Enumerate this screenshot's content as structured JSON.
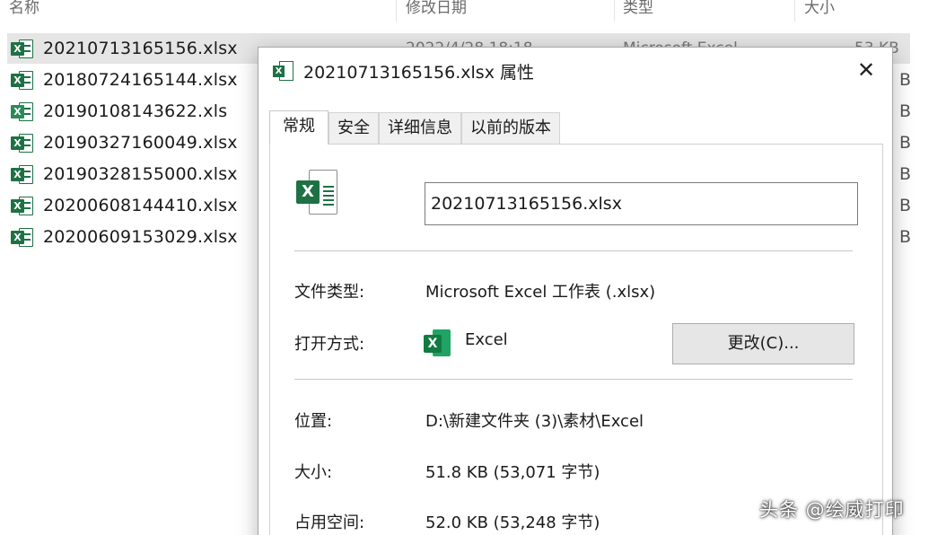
{
  "explorer": {
    "columns": [
      {
        "label": "名称"
      },
      {
        "label": "修改日期"
      },
      {
        "label": "类型"
      },
      {
        "label": "大小"
      }
    ],
    "files": [
      {
        "name": "20210713165156.xlsx",
        "icon": "excel-file-icon",
        "selected": true,
        "modified": "2022/4/28 18:18",
        "type": "Microsoft Excel",
        "size": "53 KB"
      },
      {
        "name": "20180724165144.xlsx",
        "icon": "excel-file-icon",
        "selected": false,
        "size_tail": "B"
      },
      {
        "name": "20190108143622.xls",
        "icon": "excel-legacy-file-icon",
        "selected": false,
        "size_tail": "B"
      },
      {
        "name": "20190327160049.xlsx",
        "icon": "excel-file-icon",
        "selected": false,
        "size_tail": "B"
      },
      {
        "name": "20190328155000.xlsx",
        "icon": "excel-file-icon",
        "selected": false,
        "size_tail": "B"
      },
      {
        "name": "20200608144410.xlsx",
        "icon": "excel-file-icon",
        "selected": false,
        "size_tail": "B"
      },
      {
        "name": "20200609153029.xlsx",
        "icon": "excel-file-icon",
        "selected": false,
        "size_tail": "B"
      }
    ]
  },
  "dialog": {
    "title": "20210713165156.xlsx 属性",
    "close_symbol": "✕",
    "tabs": [
      {
        "label": "常规",
        "active": true
      },
      {
        "label": "安全",
        "active": false
      },
      {
        "label": "详细信息",
        "active": false
      },
      {
        "label": "以前的版本",
        "active": false
      }
    ],
    "file_name": "20210713165156.xlsx",
    "properties": {
      "file_type_label": "文件类型:",
      "file_type_value": "Microsoft Excel 工作表 (.xlsx)",
      "opens_with_label": "打开方式:",
      "opens_with_value": "Excel",
      "change_button": "更改(C)...",
      "location_label": "位置:",
      "location_value": "D:\\新建文件夹 (3)\\素材\\Excel",
      "size_label": "大小:",
      "size_value": "51.8 KB (53,071 字节)",
      "size_on_disk_label": "占用空间:",
      "size_on_disk_value": "52.0 KB (53,248 字节)"
    }
  },
  "watermark": "头条 @绘威打印",
  "colors": {
    "excel_green": "#1e7145",
    "selection": "#e5e5e5",
    "button_face": "#e6e6e6"
  }
}
